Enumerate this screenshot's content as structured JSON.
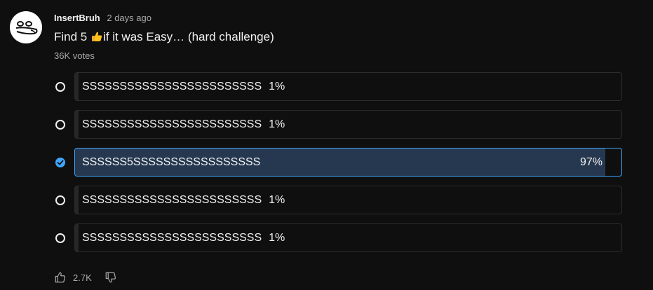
{
  "post": {
    "author": "InsertBruh",
    "time": "2 days ago",
    "title_before": "Find 5 ",
    "title_emoji": "thumbs-up-emoji",
    "title_after": "if it was Easy… (hard challenge)",
    "votes": "36K votes"
  },
  "poll": {
    "options": [
      {
        "label": "SSSSSSSSSSSSSSSSSSSSSSSS",
        "percent": "1%",
        "fraction": 0.01,
        "selected": false
      },
      {
        "label": "SSSSSSSSSSSSSSSSSSSSSSSS",
        "percent": "1%",
        "fraction": 0.01,
        "selected": false
      },
      {
        "label": "SSSSSS5SSSSSSSSSSSSSSSSS",
        "percent": "97%",
        "fraction": 0.97,
        "selected": true
      },
      {
        "label": "SSSSSSSSSSSSSSSSSSSSSSSS",
        "percent": "1%",
        "fraction": 0.01,
        "selected": false
      },
      {
        "label": "SSSSSSSSSSSSSSSSSSSSSSSS",
        "percent": "1%",
        "fraction": 0.01,
        "selected": false
      }
    ]
  },
  "actions": {
    "like_count": "2.7K",
    "like_icon": "thumbs-up-icon",
    "dislike_icon": "thumbs-down-icon"
  },
  "colors": {
    "accent": "#3ea6ff",
    "background": "#0f0f0f",
    "selected_fill": "#263850",
    "bar_fill": "#272727"
  }
}
